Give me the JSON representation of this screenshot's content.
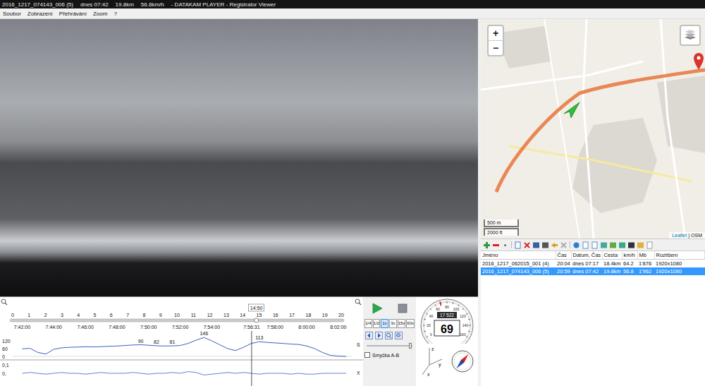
{
  "window": {
    "title_parts": [
      "2016_1217_074143_006 (5)",
      "dnes 07:42",
      "19.8km",
      "56.8km/h",
      "-  DATAKAM PLAYER - Registrator Viewer"
    ]
  },
  "menu": [
    "Soubor",
    "Zobrazení",
    "Přehrávání",
    "Zoom",
    "?"
  ],
  "map": {
    "zoom_in": "+",
    "zoom_out": "−",
    "scale": [
      "500 m",
      "2000 ft"
    ],
    "attribution": [
      "Leaflet",
      "OSM"
    ],
    "attribution_separator": "|"
  },
  "table": {
    "columns": [
      "Jméno",
      "Čas",
      "Datum, Čas",
      "Cesta",
      "km/h",
      "Mb",
      "Rozlišení"
    ],
    "rows": [
      {
        "cells": [
          "2016_1217_062015_001 (4)",
          "20:04",
          "dnes 07:17",
          "18.4km",
          "64.2",
          "1'876",
          "1920x1080"
        ],
        "selected": false
      },
      {
        "cells": [
          "2016_1217_074143_006 (5)",
          "20:59",
          "dnes 07:42",
          "19.8km",
          "56.8",
          "1'962",
          "1920x1080"
        ],
        "selected": true
      }
    ]
  },
  "timeline": {
    "ruler": [
      "0",
      "1",
      "2",
      "3",
      "4",
      "5",
      "6",
      "7",
      "8",
      "9",
      "10",
      "11",
      "12",
      "13",
      "14",
      "15",
      "16",
      "17",
      "18",
      "19",
      "20"
    ],
    "ruler_marker": "14:50",
    "time_ticks": [
      "7:42:00",
      "7:44:00",
      "7:46:00",
      "7:48:00",
      "7:50:00",
      "7:52:00",
      "7:54:00",
      "7:58:00",
      "8:00:00",
      "8:02:00"
    ],
    "cursor": "7:56:31",
    "speed_axis": [
      "120",
      "60",
      "0"
    ],
    "speed_axis_unit": "S",
    "speed": {
      "start": "7:42:00",
      "values": [
        58,
        62,
        30,
        18,
        55,
        66,
        70,
        72,
        74,
        73,
        75,
        78,
        80,
        84,
        88,
        90,
        86,
        82,
        80,
        81,
        84,
        100,
        125,
        146,
        120,
        90,
        60,
        45,
        70,
        100,
        113,
        108,
        104,
        100,
        95,
        92,
        80,
        60,
        30,
        8,
        2,
        0
      ]
    },
    "peak_labels": [
      {
        "index": 15,
        "text": "90"
      },
      {
        "index": 17,
        "text": "82"
      },
      {
        "index": 19,
        "text": "81"
      },
      {
        "index": 23,
        "text": "146"
      },
      {
        "index": 30,
        "text": "113"
      }
    ],
    "accel_axis": [
      "0,1",
      "0,"
    ],
    "accel_axis_unit": "X",
    "accel": {
      "values": [
        0,
        0.01,
        0,
        -0.01,
        0,
        0.01,
        0,
        0,
        -0.01,
        0,
        0.01,
        0,
        0,
        0,
        0.01,
        0,
        -0.01,
        0,
        0,
        0.01,
        0,
        0.02,
        0.01,
        -0.02,
        -0.01,
        0,
        0.01,
        0,
        0.01,
        0,
        -0.01,
        0,
        0,
        0,
        -0.01,
        0,
        -0.01,
        -0.01,
        0,
        0,
        0,
        0
      ]
    }
  },
  "playback": {
    "speeds": [
      {
        "label": "1/4",
        "selected": false
      },
      {
        "label": "1/2",
        "selected": false
      },
      {
        "label": "1x",
        "selected": true
      },
      {
        "label": "3x",
        "selected": false
      },
      {
        "label": "15x",
        "selected": false
      },
      {
        "label": "60x",
        "selected": false
      }
    ],
    "loop": {
      "label": "Smyčka A-B",
      "checked": false
    },
    "position_level": 0.95
  },
  "gauge": {
    "scale": [
      "0",
      "20",
      "40",
      "60",
      "80",
      "100",
      "120",
      "140",
      "160"
    ],
    "needle_level": 0.43,
    "odometer": "17 522",
    "speed": "69"
  },
  "compass": {
    "heading_deg": 40
  },
  "axes": [
    "z",
    "y",
    "x"
  ]
}
